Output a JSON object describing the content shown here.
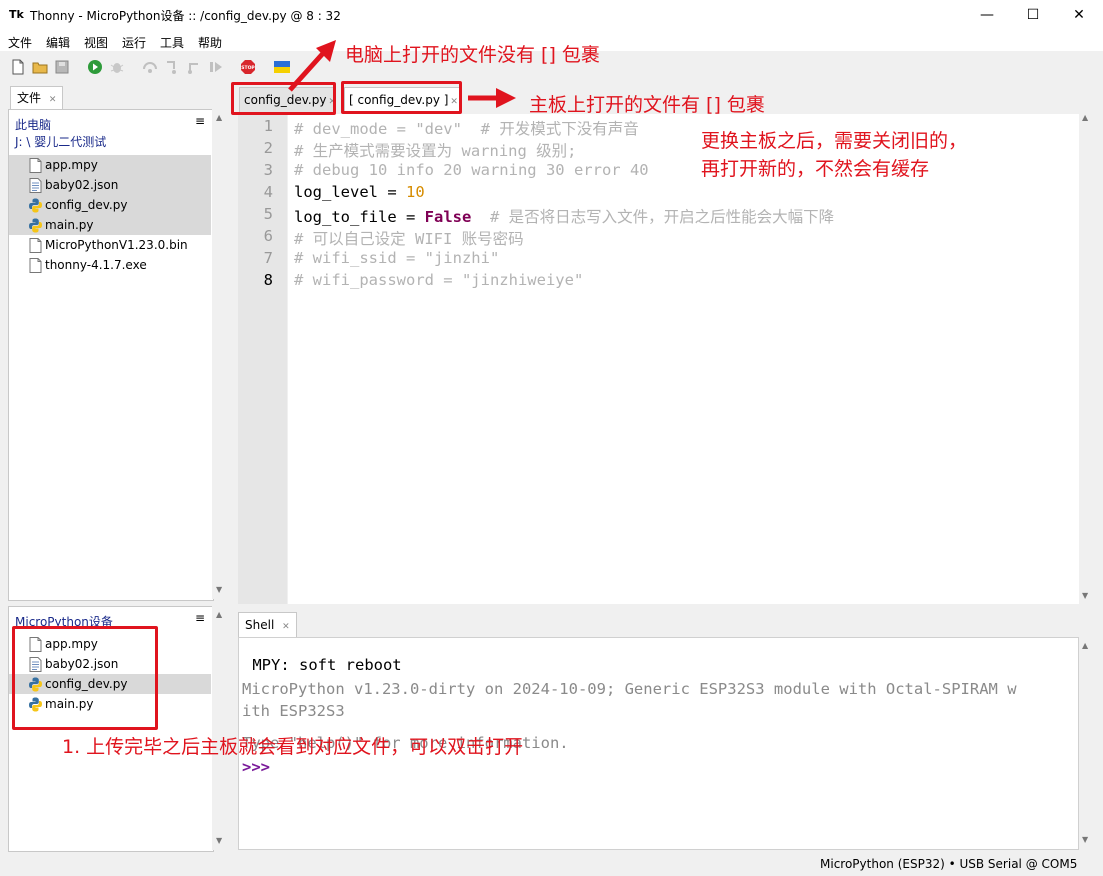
{
  "window": {
    "title": "Thonny  -  MicroPython设备 :: /config_dev.py  @  8 : 32",
    "app_icon": "Tk",
    "minimize": "—",
    "maximize": "☐",
    "close": "✕"
  },
  "menu": [
    "文件",
    "编辑",
    "视图",
    "运行",
    "工具",
    "帮助"
  ],
  "left_top": {
    "tab_label": "文件",
    "location": "此电脑",
    "path": "J: \\ 婴儿二代测试",
    "files": [
      {
        "name": "app.mpy",
        "type": "file",
        "selected": true
      },
      {
        "name": "baby02.json",
        "type": "json",
        "selected": true
      },
      {
        "name": "config_dev.py",
        "type": "python",
        "selected": true
      },
      {
        "name": "main.py",
        "type": "python",
        "selected": true
      },
      {
        "name": "MicroPythonV1.23.0.bin",
        "type": "file",
        "selected": false
      },
      {
        "name": "thonny-4.1.7.exe",
        "type": "file",
        "selected": false
      }
    ]
  },
  "left_bottom": {
    "location": "MicroPython设备",
    "files": [
      {
        "name": "app.mpy",
        "type": "file",
        "selected": false
      },
      {
        "name": "baby02.json",
        "type": "json",
        "selected": false
      },
      {
        "name": "config_dev.py",
        "type": "python",
        "selected": true
      },
      {
        "name": "main.py",
        "type": "python",
        "selected": false
      }
    ]
  },
  "editor": {
    "tabs": [
      {
        "label": "config_dev.py",
        "active": false
      },
      {
        "label": "[ config_dev.py ]",
        "active": true
      }
    ],
    "line_numbers": [
      "1",
      "2",
      "3",
      "4",
      "5",
      "6",
      "7",
      "8"
    ],
    "lines": [
      [
        {
          "t": "# dev_mode = \"dev\"  # 开发模式下没有声音",
          "c": "cmt"
        }
      ],
      [
        {
          "t": "# 生产模式需要设置为 warning 级别;",
          "c": "cmt"
        }
      ],
      [
        {
          "t": "# debug 10 info 20 warning 30 error 40",
          "c": "cmt"
        }
      ],
      [
        {
          "t": "log_level = ",
          "c": ""
        },
        {
          "t": "10",
          "c": "num"
        }
      ],
      [
        {
          "t": "log_to_file = ",
          "c": ""
        },
        {
          "t": "False",
          "c": "kw"
        },
        {
          "t": "  # 是否将日志写入文件，开启之后性能会大幅下降",
          "c": "cmt"
        }
      ],
      [
        {
          "t": "# 可以自己设定 WIFI 账号密码",
          "c": "cmt"
        }
      ],
      [
        {
          "t": "# wifi_ssid = \"jinzhi\"",
          "c": "cmt"
        }
      ],
      [
        {
          "t": "# wifi_password = \"jinzhiweiye\"",
          "c": "cmt"
        }
      ]
    ]
  },
  "shell": {
    "tab_label": "Shell",
    "line1": " MPY: soft reboot",
    "line2": "MicroPython v1.23.0-dirty on 2024-10-09; Generic ESP32S3 module with Octal-SPIRAM w",
    "line3": "ith ESP32S3",
    "line4": "Type \"help()\" for more information.",
    "prompt": ">>>"
  },
  "status": {
    "interpreter": "MicroPython (ESP32)  •  USB Serial @ COM5"
  },
  "annotations": {
    "pc_note": "电脑上打开的文件没有 [] 包裹",
    "board_note": "主板上打开的文件有 [] 包裹",
    "switch_note_1": "更换主板之后，需要关闭旧的，",
    "switch_note_2": "再打开新的，不然会有缓存",
    "upload_note": "1. 上传完毕之后主板就会看到对应文件，可以双击打开"
  },
  "colors": {
    "annotation_red": "#e0141e",
    "link_blue": "#1a2a8a",
    "keyword": "#7f0055",
    "number": "#d68c00",
    "comment": "#b3b3b3"
  }
}
